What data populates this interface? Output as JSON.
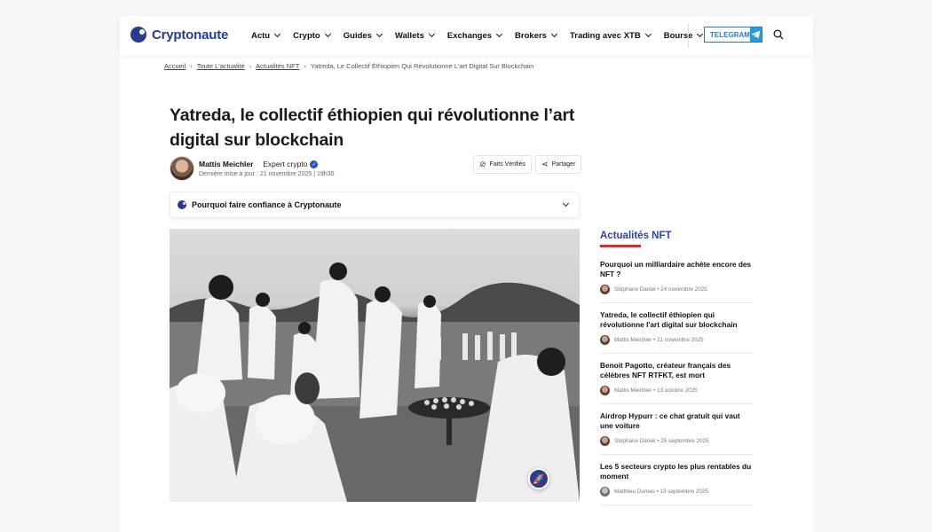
{
  "header": {
    "brand": "Cryptonaute",
    "nav": [
      {
        "label": "Actu"
      },
      {
        "label": "Crypto"
      },
      {
        "label": "Guides"
      },
      {
        "label": "Wallets"
      },
      {
        "label": "Exchanges"
      },
      {
        "label": "Brokers"
      },
      {
        "label": "Trading avec XTB"
      },
      {
        "label": "Bourse"
      }
    ],
    "telegram_label": "TELEGRAM"
  },
  "breadcrumb": {
    "items": [
      "Accueil",
      "Toute L'actualité",
      "Actualités NFT"
    ],
    "current": "Yatreda, Le Collectif Éthiopien Qui Révolutionne L'art Digital Sur Blockchain"
  },
  "article": {
    "title": "Yatreda, le collectif éthiopien qui révolutionne l’art digital sur blockchain",
    "author_name": "Mattis Meichler",
    "author_role": "Expert crypto",
    "updated_label": "Dernière mise à jour :",
    "updated_value": "21 novembre 2025 | 19h30",
    "facts_label": "Faits Vérifiés",
    "share_label": "Partager",
    "trust_label": "Pourquoi faire confiance à Cryptonaute"
  },
  "sidebar": {
    "title": "Actualités NFT",
    "items": [
      {
        "title": "Pourquoi un milliardaire achète encore des NFT ?",
        "author": "Stéphane Daniel",
        "date": "24 novembre 2025"
      },
      {
        "title": "Yatreda, le collectif éthiopien qui révolutionne l'art digital sur blockchain",
        "author": "Mattis Meichler",
        "date": "21 novembre 2025"
      },
      {
        "title": "Benoit Pagotto, créateur français des célèbres NFT RTFKT, est mort",
        "author": "Mattis Meichler",
        "date": "13 octobre 2025"
      },
      {
        "title": "Airdrop Hypurr : ce chat gratuit qui vaut une voiture",
        "author": "Stéphane Daniel",
        "date": "25 septembre 2025"
      },
      {
        "title": "Les 5 secteurs crypto les plus rentables du moment",
        "author": "Matthieu Dumas",
        "date": "19 septembre 2025"
      }
    ]
  },
  "colors": {
    "brand": "#2b3a8f",
    "accent_blue": "#2d3fb0",
    "accent_red": "#e02a2a",
    "telegram": "#2a9ae0"
  }
}
